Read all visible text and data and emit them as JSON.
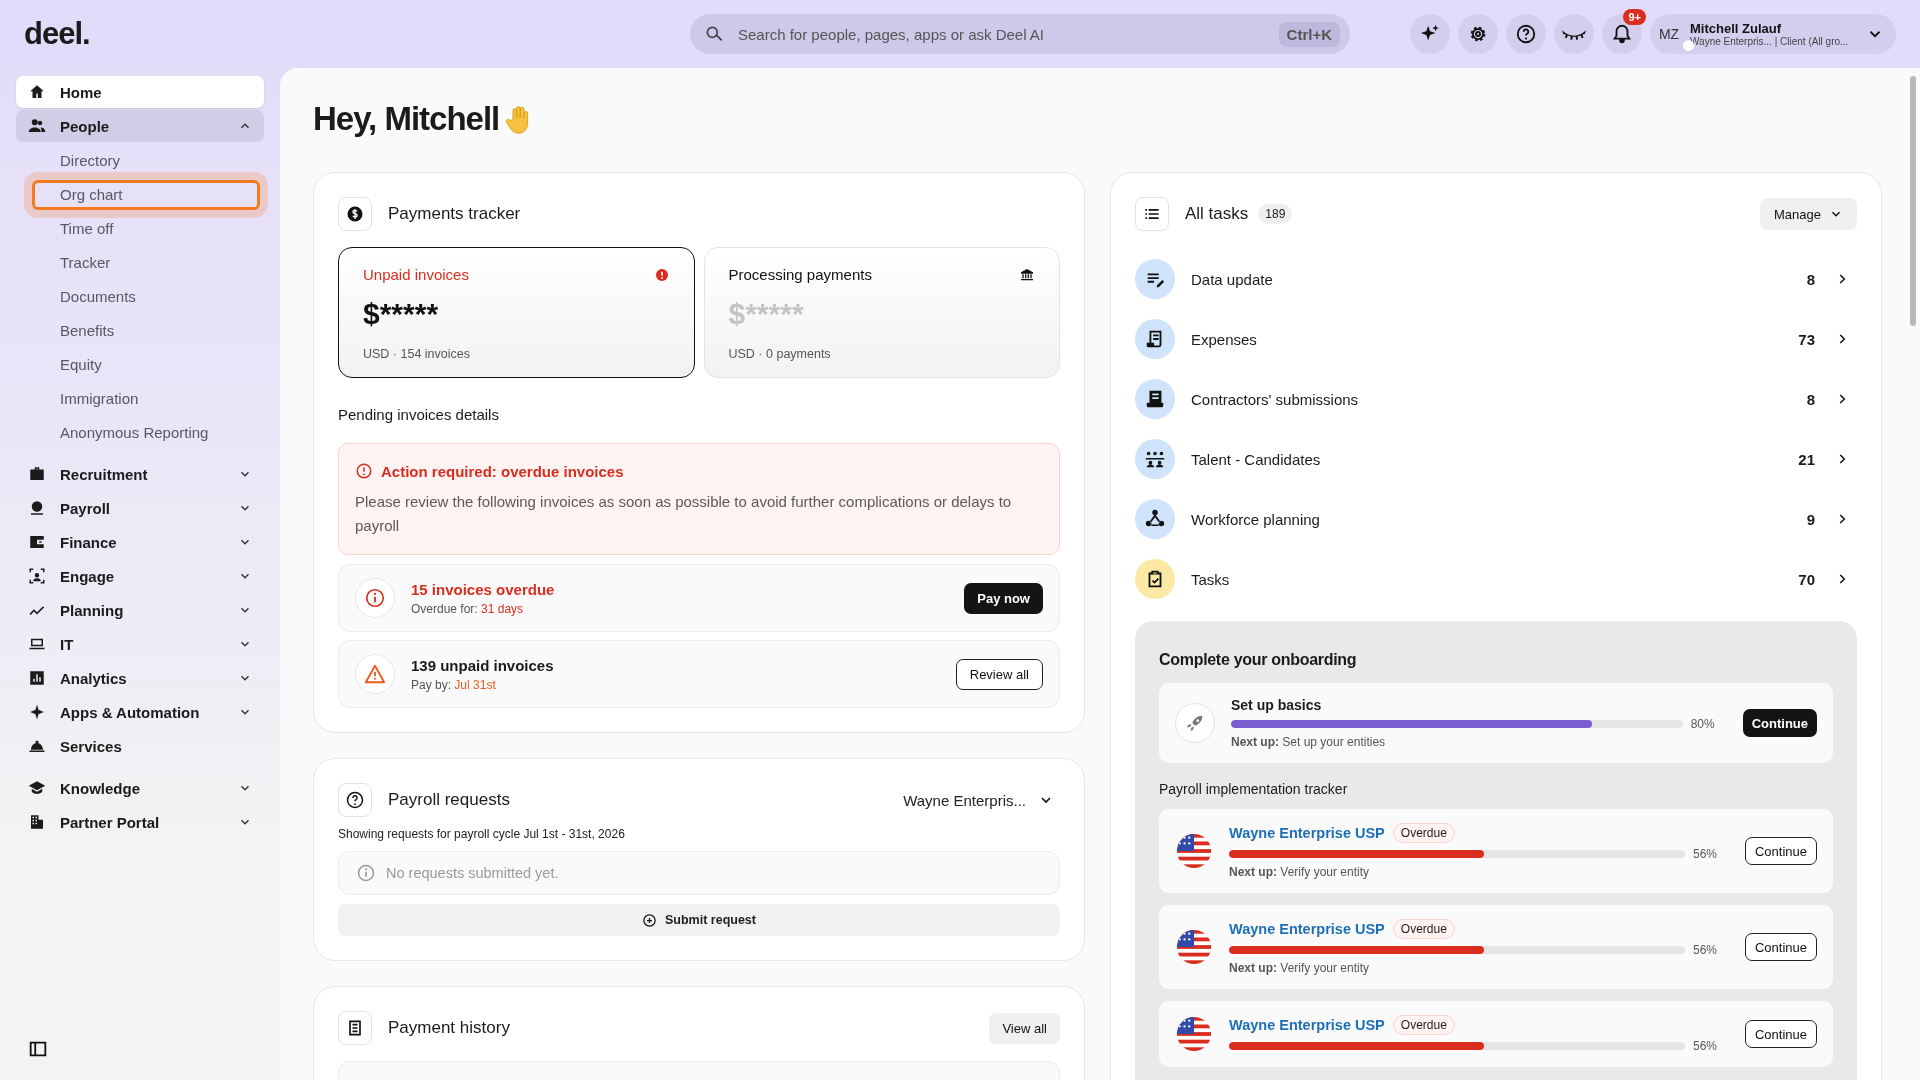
{
  "logo": "deel.",
  "search": {
    "placeholder": "Search for people, pages, apps or ask Deel AI",
    "shortcut": "Ctrl+K"
  },
  "notifications": {
    "badge": "9+"
  },
  "user": {
    "initials": "MZ",
    "name": "Mitchell Zulauf",
    "subtitle": "Wayne Enterpris... | Client (All gro..."
  },
  "sidebar": {
    "items": [
      {
        "label": "Home",
        "selected": true
      },
      {
        "label": "People",
        "selected": false,
        "expanded": true,
        "children": [
          {
            "label": "Directory",
            "focused": false
          },
          {
            "label": "Org chart",
            "focused": true
          },
          {
            "label": "Time off",
            "focused": false
          },
          {
            "label": "Tracker",
            "focused": false
          },
          {
            "label": "Documents",
            "focused": false
          },
          {
            "label": "Benefits",
            "focused": false
          },
          {
            "label": "Equity",
            "focused": false
          },
          {
            "label": "Immigration",
            "focused": false
          },
          {
            "label": "Anonymous Reporting",
            "focused": false
          }
        ]
      },
      {
        "label": "Recruitment",
        "selected": false,
        "expanded": false
      },
      {
        "label": "Payroll",
        "selected": false,
        "expanded": false
      },
      {
        "label": "Finance",
        "selected": false,
        "expanded": false
      },
      {
        "label": "Engage",
        "selected": false,
        "expanded": false
      },
      {
        "label": "Planning",
        "selected": false,
        "expanded": false
      },
      {
        "label": "IT",
        "selected": false,
        "expanded": false
      },
      {
        "label": "Analytics",
        "selected": false,
        "expanded": false
      },
      {
        "label": "Apps & Automation",
        "selected": false,
        "expanded": false
      },
      {
        "label": "Services",
        "selected": false
      },
      {
        "label": "Knowledge",
        "selected": false,
        "expanded": false
      },
      {
        "label": "Partner Portal",
        "selected": false,
        "expanded": false
      }
    ]
  },
  "greeting": "Hey, Mitchell",
  "payments_tracker": {
    "title": "Payments tracker",
    "cards": [
      {
        "kind": "alert",
        "title": "Unpaid invoices",
        "amount": "$*****",
        "meta": "USD · 154 invoices",
        "selected": true
      },
      {
        "kind": "bank",
        "title": "Processing payments",
        "amount": "$*****",
        "meta": "USD · 0 payments",
        "selected": false
      }
    ],
    "pending_title": "Pending invoices details",
    "alert": {
      "title": "Action required: overdue invoices",
      "body": "Please review the following invoices as soon as possible to avoid further complications or delays to payroll"
    },
    "rows": [
      {
        "kind": "overdue",
        "title": "15 invoices overdue",
        "detail_label": "Overdue for:",
        "detail_value": "31 days",
        "button": "Pay now"
      },
      {
        "kind": "unpaid",
        "title": "139 unpaid invoices",
        "detail_label": "Pay by:",
        "detail_value": "Jul 31st",
        "button": "Review all"
      }
    ]
  },
  "payroll_requests": {
    "title": "Payroll requests",
    "entity": "Wayne Enterpris...",
    "subtitle": "Showing requests for payroll cycle Jul 1st - 31st, 2026",
    "empty": "No requests submitted yet.",
    "button": "Submit request"
  },
  "payment_history": {
    "title": "Payment history",
    "button": "View all"
  },
  "tasks": {
    "title": "All tasks",
    "count": "189",
    "manage": "Manage",
    "items": [
      {
        "kind": "data",
        "label": "Data update",
        "count": "8"
      },
      {
        "kind": "expenses",
        "label": "Expenses",
        "count": "73"
      },
      {
        "kind": "submissions",
        "label": "Contractors' submissions",
        "count": "8"
      },
      {
        "kind": "talent",
        "label": "Talent - Candidates",
        "count": "21"
      },
      {
        "kind": "workforce",
        "label": "Workforce planning",
        "count": "9"
      },
      {
        "kind": "tasks",
        "label": "Tasks",
        "count": "70"
      }
    ]
  },
  "onboarding": {
    "title": "Complete your onboarding",
    "basics": {
      "title": "Set up basics",
      "level": 0.8,
      "percent": "80%",
      "next_label": "Next up:",
      "next": "Set up your entities",
      "button": "Continue"
    },
    "tracker_title": "Payroll implementation tracker",
    "trackers": [
      {
        "name": "Wayne Enterprise USP",
        "status": "Overdue",
        "level": 0.56,
        "percent": "56%",
        "next_label": "Next up:",
        "next": "Verify your entity",
        "button": "Continue"
      },
      {
        "name": "Wayne Enterprise USP",
        "status": "Overdue",
        "level": 0.56,
        "percent": "56%",
        "next_label": "Next up:",
        "next": "Verify your entity",
        "button": "Continue"
      },
      {
        "name": "Wayne Enterprise USP",
        "status": "Overdue",
        "level": 0.56,
        "percent": "56%",
        "button": "Continue"
      }
    ]
  }
}
